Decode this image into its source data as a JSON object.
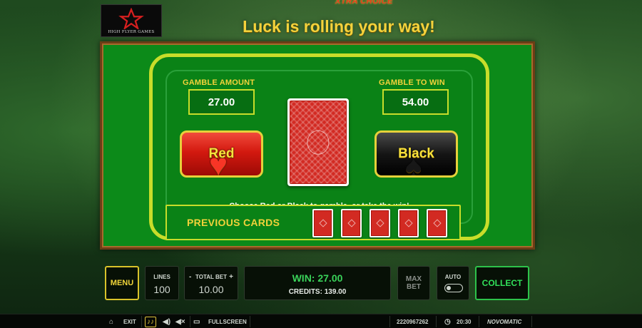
{
  "header": {
    "logo_text": "HIGH FLYER GAMES",
    "game_tag": "XTRA CHOICE",
    "headline": "Luck is rolling your way!"
  },
  "gamble": {
    "gamble_amount_label": "GAMBLE AMOUNT",
    "gamble_amount_value": "27.00",
    "gamble_to_win_label": "GAMBLE TO WIN",
    "gamble_to_win_value": "54.00",
    "red_button": "Red",
    "black_button": "Black",
    "instruction": "Choose Red or Black to gamble, or take the win!",
    "previous_cards_label": "PREVIOUS CARDS",
    "previous_cards_count": 5
  },
  "controls": {
    "menu": "MENU",
    "lines_label": "LINES",
    "lines_value": "100",
    "total_bet_label": "TOTAL BET",
    "total_bet_value": "10.00",
    "minus": "-",
    "plus": "+",
    "win": "WIN: 27.00",
    "credits": "CREDITS: 139.00",
    "max_bet_line1": "MAX",
    "max_bet_line2": "BET",
    "auto": "AUTO",
    "collect": "COLLECT"
  },
  "statusbar": {
    "exit": "EXIT",
    "fullscreen": "FULLSCREEN",
    "session_id": "2220967262",
    "time": "20:30",
    "brand": "NOVOMATIC"
  },
  "colors": {
    "felt": "#0a8216",
    "gold": "#f2d23a",
    "win_green": "#3ad35a",
    "red_button": "#d3190f",
    "black_button": "#151515"
  }
}
